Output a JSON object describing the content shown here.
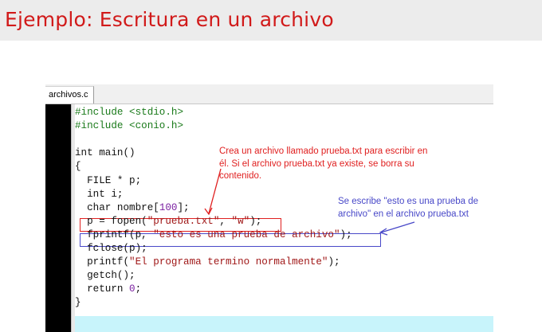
{
  "slide": {
    "title": "Ejemplo: Escritura en un archivo"
  },
  "editor": {
    "tab_label": "archivos.c",
    "code": [
      {
        "parts": [
          {
            "c": "pp",
            "t": "#include <stdio.h>"
          }
        ]
      },
      {
        "parts": [
          {
            "c": "pp",
            "t": "#include <conio.h>"
          }
        ]
      },
      {
        "parts": [
          {
            "c": "",
            "t": ""
          }
        ]
      },
      {
        "parts": [
          {
            "c": "kw",
            "t": "int main()"
          }
        ]
      },
      {
        "parts": [
          {
            "c": "kw",
            "t": "{"
          }
        ]
      },
      {
        "parts": [
          {
            "c": "kw",
            "t": "  FILE * p;"
          }
        ]
      },
      {
        "parts": [
          {
            "c": "kw",
            "t": "  int i;"
          }
        ]
      },
      {
        "parts": [
          {
            "c": "kw",
            "t": "  char nombre["
          },
          {
            "c": "num",
            "t": "100"
          },
          {
            "c": "kw",
            "t": "];"
          }
        ]
      },
      {
        "parts": [
          {
            "c": "kw",
            "t": "  p = fopen("
          },
          {
            "c": "str",
            "t": "\"prueba.txt\""
          },
          {
            "c": "kw",
            "t": ", "
          },
          {
            "c": "str",
            "t": "\"w\""
          },
          {
            "c": "kw",
            "t": ");"
          }
        ]
      },
      {
        "parts": [
          {
            "c": "kw",
            "t": "  fprintf(p, "
          },
          {
            "c": "str",
            "t": "\"esto es una prueba de archivo\""
          },
          {
            "c": "kw",
            "t": ");"
          }
        ]
      },
      {
        "parts": [
          {
            "c": "kw",
            "t": "  fclose(p);"
          }
        ]
      },
      {
        "parts": [
          {
            "c": "kw",
            "t": "  printf("
          },
          {
            "c": "str",
            "t": "\"El programa termino normalmente\""
          },
          {
            "c": "kw",
            "t": ");"
          }
        ]
      },
      {
        "parts": [
          {
            "c": "kw",
            "t": "  getch();"
          }
        ]
      },
      {
        "parts": [
          {
            "c": "kw",
            "t": "  return "
          },
          {
            "c": "num",
            "t": "0"
          },
          {
            "c": "kw",
            "t": ";"
          }
        ]
      },
      {
        "parts": [
          {
            "c": "kw",
            "t": "}"
          }
        ]
      }
    ]
  },
  "annotations": {
    "red_note": [
      "Crea un archivo llamado prueba.txt para escribir en",
      "él. Si el archivo prueba.txt ya existe, se borra su",
      "contenido."
    ],
    "blue_note": [
      "Se escribe \"esto es una prueba de",
      "archivo\" en el archivo prueba.txt"
    ],
    "red_color": "#e02020",
    "blue_color": "#4848c8"
  }
}
